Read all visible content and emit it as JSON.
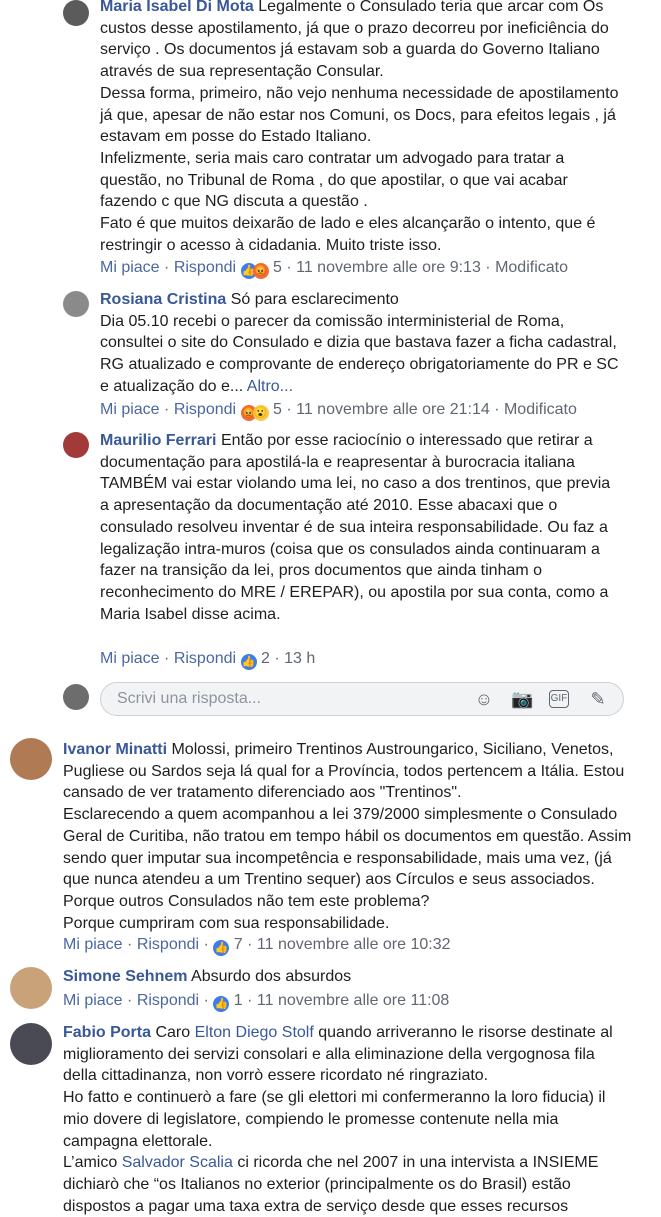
{
  "comments": [
    {
      "author": "Maria Isabel Di Mota",
      "text": "Legalmente o Consulado teria que arcar com Os custos desse apostilamento, já que o prazo decorreu por ineficiência do serviço . Os documentos já estavam sob a guarda do Governo Italiano através de sua representação Consular.\nDessa forma, primeiro, não vejo nenhuma necessidade de apostilamento já que, apesar de não estar nos Comuni, os Docs, para efeitos legais , já estavam em posse do Estado Italiano.\nInfelizmente, seria mais caro contratar um advogado para tratar a questão, no Tribunal de Roma , do que apostilar, o que vai acabar fazendo c que NG discuta a questão .\nFato é que muitos deixarão de lado e eles alcançarão o intento, que é restringir o acesso à cidadania. Muito triste isso.",
      "like": "Mi piace",
      "reply": "Rispondi",
      "count": "5",
      "time": "11 novembre alle ore 9:13",
      "edited": "Modificato",
      "reactions": [
        "like-icon",
        "angry-icon"
      ]
    },
    {
      "author": "Rosiana Cristina",
      "text": "Só para esclarecimento\nDia 05.10 recebi o parecer da comissão interministerial de Roma, consultei o site do Consulado e dizia que bastava fazer a ficha cadastral, RG atualizado e comprovante de endereço obrigatoriamente do PR e SC e atualização do e...",
      "more": "Altro...",
      "like": "Mi piace",
      "reply": "Rispondi",
      "count": "5",
      "time": "11 novembre alle ore 21:14",
      "edited": "Modificato",
      "reactions": [
        "angry-icon",
        "wow-icon"
      ]
    },
    {
      "author": "Maurilio Ferrari",
      "text": "Então por esse raciocínio o interessado que retirar a documentação para apostilá-la e reapresentar à burocracia italiana TAMBÉM vai estar violando uma lei, no caso a dos trentinos, que previa a apresentação da documentação até 2010. Esse abacaxi que o consulado resolveu inventar é de sua inteira responsabilidade. Ou faz a legalização intra-muros (coisa que os consulados ainda continuaram a fazer na transição da lei, pros documentos que ainda tinham o reconhecimento do MRE / EREPAR), ou apostila por sua conta, como a Maria Isabel disse acima.",
      "like": "Mi piace",
      "reply": "Rispondi",
      "count": "2",
      "time": "13 h",
      "reactions": [
        "like-icon"
      ]
    }
  ],
  "reply_box": {
    "placeholder": "Scrivi una risposta..."
  },
  "top_comments": [
    {
      "author": "Ivanor Minatti",
      "text": "Molossi, primeiro Trentinos Austroungarico, Siciliano, Venetos, Pugliese ou Sardos seja lá qual for a Província, todos pertencem a Itália. Estou cansado de ver tratamento diferenciado aos \"Trentinos\".\nEsclarecendo a quem acompanhou a lei 379/2000 simplesmente o Consulado Geral de Curitiba, não tratou em tempo hábil os documentos em questão. Assim sendo quer imputar sua incompetência e responsabilidade, mais uma vez, (já que nunca atendeu a um Trentino sequer) aos Círculos e seus associados. Porque outros Consulados não tem este problema?\nPorque cumpriram com sua responsabilidade.",
      "like": "Mi piace",
      "reply": "Rispondi",
      "count": "7",
      "time": "11 novembre alle ore 10:32"
    },
    {
      "author": "Simone Sehnem",
      "text": "Absurdo dos absurdos",
      "like": "Mi piace",
      "reply": "Rispondi",
      "count": "1",
      "time": "11 novembre alle ore 11:08"
    },
    {
      "author": "Fabio Porta",
      "text_a": "Caro",
      "mention_1": "Elton Diego Stolf",
      "text_b": "quando arriveranno le risorse destinate al miglioramento dei servizi consolari e alla eliminazione della vergognosa fila della cittadinanza, non vorrò essere ricordato né ringraziato.\nHo fatto e continuerò a fare (se gli elettori mi confermeranno la loro fiducia) il mio dovere di legislatore, compiendo le promesse contenute nella mia campagna elettorale.\nL’amico",
      "mention_2": "Salvador Scalia",
      "text_c": "ci ricorda che nel 2007 in una intervista a INSIEME dichiarò che “os Italianos no exterior (principalmente os do Brasil) estão dispostos a pagar uma taxa extra de serviço desde que esses recursos"
    }
  ],
  "separator": "·",
  "colors": {
    "link": "#385898",
    "meta": "#606770",
    "like": "#3b7ded",
    "angry": "#f26b3a",
    "wow": "#f7c94b"
  }
}
